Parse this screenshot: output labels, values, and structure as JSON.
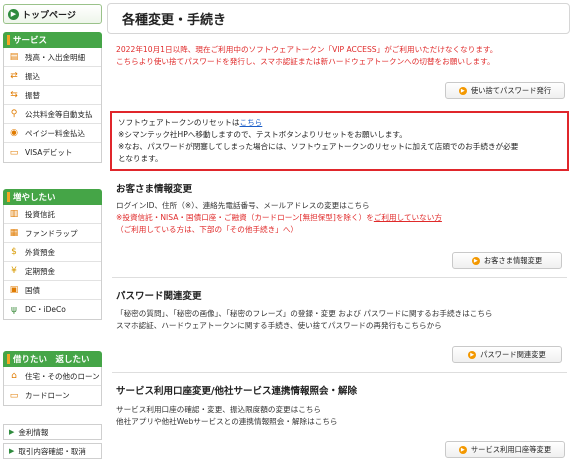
{
  "sidebar": {
    "top_page": "トップページ",
    "services": {
      "heading": "サービス",
      "items": [
        "残高・入出金明細",
        "振込",
        "振替",
        "公共料金等自動支払",
        "ペイジー料金払込",
        "VISAデビット"
      ]
    },
    "grow": {
      "heading": "増やしたい",
      "items": [
        "投資信託",
        "ファンドラップ",
        "外貨預金",
        "定期預金",
        "国債",
        "DC・iDeCo"
      ]
    },
    "borrow": {
      "heading": "借りたい　返したい",
      "items": [
        "住宅・その他のローン",
        "カードローン"
      ]
    },
    "links": [
      "金利情報",
      "取引内容確認・取消"
    ]
  },
  "main": {
    "title": "各種変更・手続き",
    "notice_line1": "2022年10月1日以降、現在ご利用中のソフトウェアトークン「VIP ACCESS」がご利用いただけなくなります。",
    "notice_line2": "こちらより使い捨てパスワードを発行し、スマホ認証または新ハードウェアトークンへの切替をお願いします。",
    "otp_button": "使い捨てパスワード発行",
    "token_box": {
      "line1_prefix": "ソフトウェアトークンのリセットは",
      "line1_link": "こちら",
      "line2": "※シマンテック社HPへ移動しますので、テストボタンよりリセットをお願いします。",
      "line3": "※なお、パスワードが閉塞してしまった場合には、ソフトウェアトークンのリセットに加えて店頭でのお手続きが必要",
      "line4": "となります。"
    },
    "customer": {
      "heading": "お客さま情報変更",
      "line1": "ログインID、住所（※）、連絡先電話番号、メールアドレスの変更はこちら",
      "line2_a": "※投資信託・NISA・国債口座・ご融資（カードローン[無担保型]を除く）を",
      "line2_b": "ご利用していない方",
      "line3": "（ご利用している方は、下部の「その他手続き」へ）",
      "button": "お客さま情報変更"
    },
    "password": {
      "heading": "パスワード関連変更",
      "line1": "「秘密の質問」、「秘密の画像」、「秘密のフレーズ」の登録・変更 および パスワードに関するお手続きはこちら",
      "line2": "スマホ認証、ハードウェアトークンに関する手続き、使い捨てパスワードの再発行もこちらから",
      "button": "パスワード関連変更"
    },
    "account": {
      "heading": "サービス利用口座変更/他社サービス連携情報照会・解除",
      "line1": "サービス利用口座の確認・変更、振込限度額の変更はこちら",
      "line2": "他社アプリや他社Webサービスとの連携情報照会・解除はこちら",
      "button": "サービス利用口座等変更"
    }
  }
}
